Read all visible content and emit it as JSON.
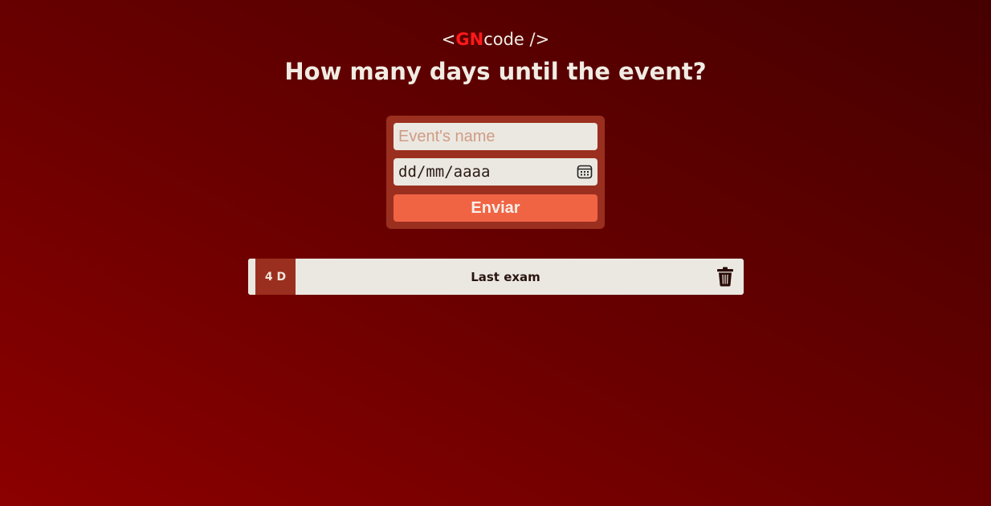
{
  "logo": {
    "open": "<",
    "brand": "GN",
    "suffix": "code />"
  },
  "title": "How many days until the event?",
  "form": {
    "name_placeholder": "Event's name",
    "name_value": "",
    "date_placeholder": "dd/mm/aaaa",
    "calendar_icon": "calendar-icon",
    "submit_label": "Enviar"
  },
  "events": [
    {
      "days": "4 D",
      "name": "Last exam",
      "delete_icon": "trash-icon"
    }
  ],
  "colors": {
    "accent": "#ff1a1a",
    "card": "#9b2f1f",
    "button": "#f06444",
    "field": "#ebe8e1"
  }
}
